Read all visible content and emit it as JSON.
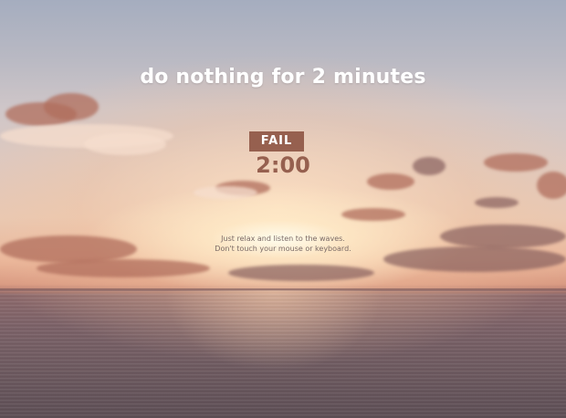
{
  "headline": "do nothing for 2 minutes",
  "status": "FAIL",
  "timer": "2:00",
  "instructions": {
    "line1": "Just relax and listen to the waves.",
    "line2": "Don't touch your mouse or keyboard."
  },
  "colors": {
    "accent": "#96604f",
    "headline_text": "#ffffff",
    "instruction_text": "#7a6a66"
  },
  "background": "sunset-over-ocean"
}
